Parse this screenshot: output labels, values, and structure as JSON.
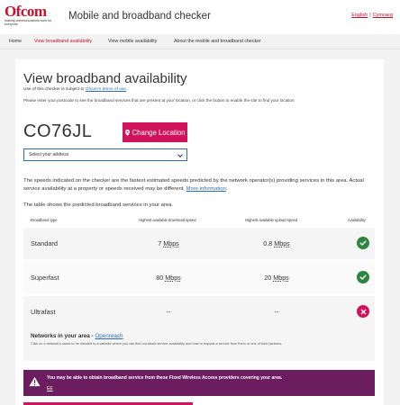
{
  "header": {
    "logo_word": "Ofcom",
    "logo_tagline": "making communications work for everyone",
    "title": "Mobile and broadband checker",
    "lang_english": "English",
    "lang_separator": "|",
    "lang_welsh": "Cymraeg"
  },
  "nav": [
    {
      "label": "Home"
    },
    {
      "label": "View broadband availability",
      "active": true
    },
    {
      "label": "View mobile availability"
    },
    {
      "label": "About the mobile and broadband checker"
    }
  ],
  "page": {
    "heading": "View broadband availability",
    "terms_prefix": "Use of this checker is subject to ",
    "terms_link": "Ofcom's terms of use",
    "terms_suffix": ".",
    "intro": "Please enter your postcode to see the broadband services that are present at your location, or click the button to enable the site to find your location",
    "postcode": "CO76JL",
    "change_location_label": "Change Location",
    "address_select_value": "Select your address",
    "note_text": "The speeds indicated on the checker are the fastest estimated speeds predicted by the network operator(s) providing services in this area. Actual service availability at a property or speeds received may be different. ",
    "note_link": "More information",
    "note_suffix": ".",
    "table_intro": "The table shows the predicted broadband services in your area."
  },
  "table": {
    "headers": [
      "Broadband type",
      "Highest available download speed",
      "Highest available upload speed",
      "Availability"
    ],
    "rows": [
      {
        "type": "Standard",
        "download_value": "7",
        "download_unit": "Mbps",
        "upload_value": "0.8",
        "upload_unit": "Mbps",
        "available": true
      },
      {
        "type": "Superfast",
        "download_value": "80",
        "download_unit": "Mbps",
        "upload_value": "20",
        "upload_unit": "Mbps",
        "available": true
      },
      {
        "type": "Ultrafast",
        "download_value": "--",
        "download_unit": "",
        "upload_value": "--",
        "upload_unit": "",
        "available": false
      }
    ]
  },
  "networks": {
    "title": "Networks in your area - ",
    "link": "Openreach",
    "description": "Click on a network's name to be directed to a website where you can find out about service availability and how to request a service from them or one of their partners."
  },
  "fwa_banner": {
    "text": "You may be able to obtain broadband service from these Fixed Wireless Access providers covering your area.",
    "provider_link": "EE"
  },
  "colors": {
    "brand": "#c8102e",
    "button": "#d1135d",
    "available": "#2e8540",
    "unavailable": "#d1135d",
    "banner": "#6c1d5f",
    "link": "#2c6fb7"
  }
}
